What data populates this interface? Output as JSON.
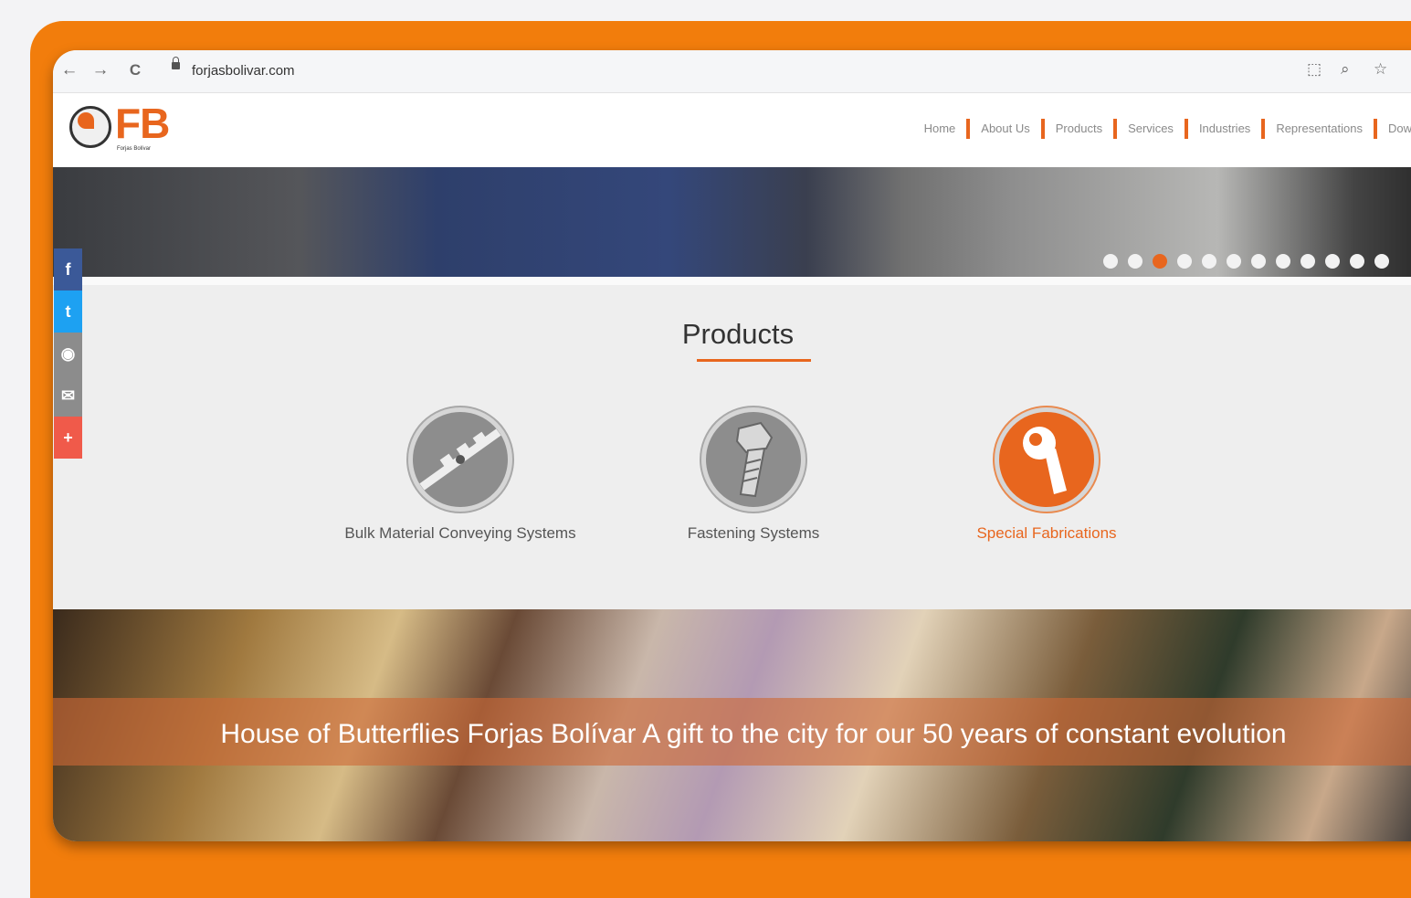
{
  "browser": {
    "back_icon": "←",
    "forward_icon": "→",
    "reload_icon": "C",
    "url": "forjasbolivar.com",
    "translate_icon": "⬚",
    "zoom_icon": "⌕",
    "star_icon": "☆"
  },
  "site": {
    "logo_text": "FB",
    "logo_subtext": "Forjas Bolívar",
    "nav": [
      "Home",
      "About Us",
      "Products",
      "Services",
      "Industries",
      "Representations",
      "Dow"
    ]
  },
  "hero": {
    "slide_count": 12,
    "active_slide_index": 2
  },
  "products": {
    "title": "Products",
    "items": [
      {
        "label": "Bulk Material Conveying Systems"
      },
      {
        "label": "Fastening Systems"
      },
      {
        "label": "Special Fabrications"
      }
    ]
  },
  "banner": {
    "text": "House of Butterflies Forjas Bolívar A gift to the city for our 50 years of constant evolution"
  },
  "social": [
    {
      "glyph": "f",
      "color": "#3b5998"
    },
    {
      "glyph": "t",
      "color": "#1da1f2"
    },
    {
      "glyph": "◉",
      "color": "#8c8c8c"
    },
    {
      "glyph": "✉",
      "color": "#8c8c8c"
    },
    {
      "glyph": "+",
      "color": "#f05a4a"
    }
  ],
  "colors": {
    "frame": "#f27d0c",
    "accent": "#e8661e"
  }
}
